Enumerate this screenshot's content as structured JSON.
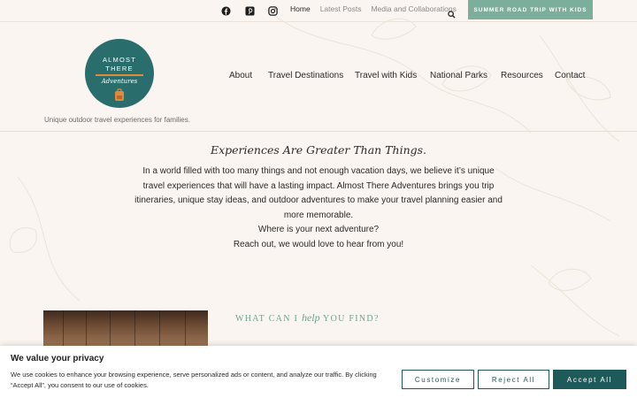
{
  "colors": {
    "background": "#faf5f0",
    "brand_teal": "#2a6d6d",
    "cta_green": "#7cae9c",
    "accent_orange": "#e08b3c",
    "button_teal": "#1e5a5a"
  },
  "topbar": {
    "social_icons": [
      "facebook-icon",
      "pinterest-icon",
      "instagram-icon"
    ],
    "links": [
      {
        "label": "Home",
        "active": true
      },
      {
        "label": "Latest Posts",
        "active": false
      },
      {
        "label": "Media and Collaborations",
        "active": false
      }
    ],
    "search_icon": "search-icon",
    "cta_label": "SUMMER ROAD TRIP WITH KIDS"
  },
  "logo": {
    "line1": "ALMOST",
    "line2": "THERE",
    "line3": "Adventures"
  },
  "tagline": "Unique outdoor travel experiences for families.",
  "nav": [
    "About",
    "Travel Destinations",
    "Travel with Kids",
    "National Parks",
    "Resources",
    "Contact"
  ],
  "intro": {
    "headline": "Experiences Are Greater Than Things.",
    "lines": [
      "In a world filled with too many things and not enough vacation days, we believe it’s unique",
      "travel experiences that will have a lasting impact. Almost There Adventures brings you trip",
      "itineraries, unique stay ideas, and outdoor adventures to make your travel planning easier and",
      "more memorable.",
      "Where is your next adventure?",
      "Reach out, we would love to hear from you!"
    ]
  },
  "help": {
    "before": "WHAT CAN I ",
    "script": "help",
    "after": " YOU FIND?"
  },
  "cookie": {
    "title": "We value your privacy",
    "text": "We use cookies to enhance your browsing experience, serve personalized ads or content, and analyze our traffic. By clicking “Accept All”, you consent to our use of cookies.",
    "customize": "Customize",
    "reject": "Reject All",
    "accept": "Accept All"
  }
}
